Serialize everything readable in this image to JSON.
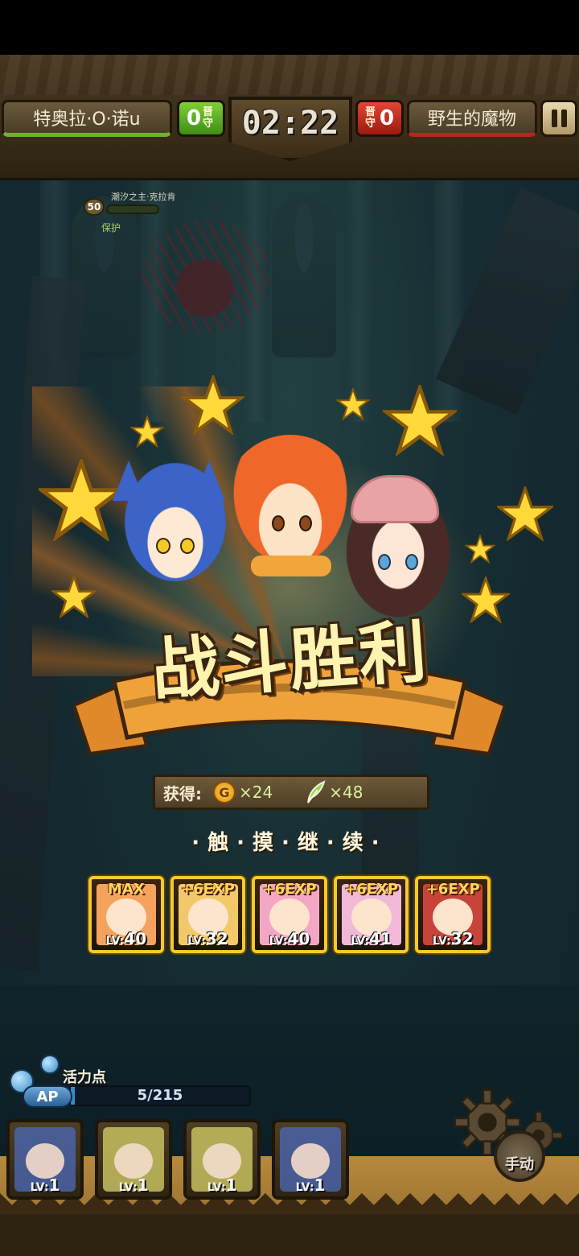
{
  "top_bar": {
    "player_name": "特奥拉·O·诺u",
    "player_score": "0",
    "player_score_label": "晋守",
    "timer": "02:22",
    "enemy_score": "0",
    "enemy_score_label": "晋守",
    "enemy_name": "野生的魔物",
    "pause_icon": "pause-icon"
  },
  "enemy_unit": {
    "name": "潮汐之主·克拉肯",
    "level": "50",
    "tag": "保护",
    "hp_fraction": 0
  },
  "result": {
    "title": "战斗胜利",
    "reward_label": "获得:",
    "coin_icon": "gold-coin-icon",
    "coin_letter": "G",
    "coin_amount": "×24",
    "feather_icon": "feather-icon",
    "feather_amount": "×48",
    "continue_text": "·触·摸·继·续·"
  },
  "reward_cards": [
    {
      "exp": "MAX",
      "lv_prefix": "LV:",
      "lv": "40",
      "color": "#f5a35c"
    },
    {
      "exp": "+6EXP",
      "lv_prefix": "LV:",
      "lv": "32",
      "color": "#f3c86a"
    },
    {
      "exp": "+6EXP",
      "lv_prefix": "LV:",
      "lv": "40",
      "color": "#f4a7c4"
    },
    {
      "exp": "+6EXP",
      "lv_prefix": "LV:",
      "lv": "41",
      "color": "#f2b8d8"
    },
    {
      "exp": "+6EXP",
      "lv_prefix": "LV:",
      "lv": "32",
      "color": "#c8443a"
    }
  ],
  "ap": {
    "label": "活力点",
    "badge": "AP",
    "value": "5/215",
    "fraction": 0.023
  },
  "party": [
    {
      "lv_prefix": "LV:",
      "lv": "1",
      "color": "#4a64a8"
    },
    {
      "lv_prefix": "LV:",
      "lv": "1",
      "color": "#c8c060"
    },
    {
      "lv_prefix": "LV:",
      "lv": "1",
      "color": "#c8c060"
    },
    {
      "lv_prefix": "LV:",
      "lv": "1",
      "color": "#4a64a8"
    }
  ],
  "controls": {
    "settings_icon": "gear-icon",
    "manual_label": "手动"
  },
  "colors": {
    "ally": "#6fb22c",
    "enemy": "#b8261c",
    "card_border": "#f3cb2a",
    "banner_orange": "#f0a23a"
  }
}
